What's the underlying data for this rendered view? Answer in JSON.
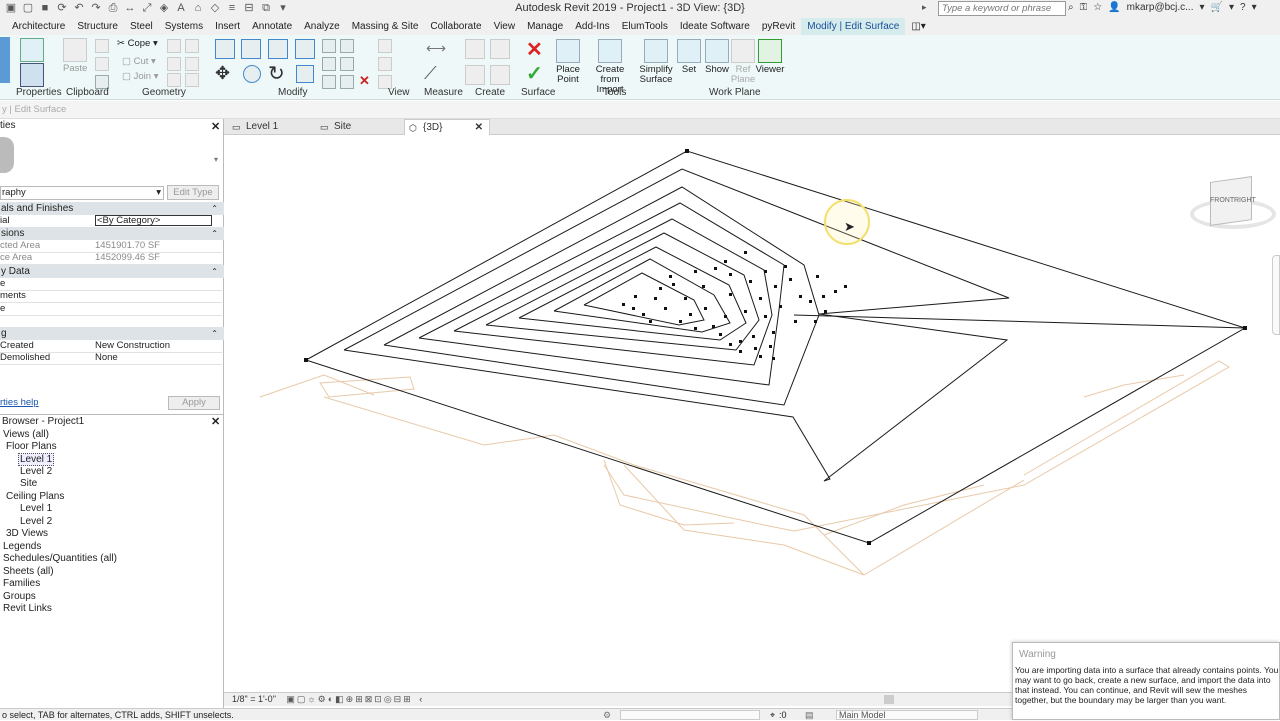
{
  "app": {
    "title": "Autodesk Revit 2019 - Project1 - 3D View: {3D}",
    "search_placeholder": "Type a keyword or phrase",
    "user": "mkarp@bcj.c..."
  },
  "menu_tabs": [
    "Architecture",
    "Structure",
    "Steel",
    "Systems",
    "Insert",
    "Annotate",
    "Analyze",
    "Massing & Site",
    "Collaborate",
    "View",
    "Manage",
    "Add-Ins",
    "ElumTools",
    "Ideate Software",
    "pyRevit",
    "Modify | Edit Surface"
  ],
  "ribbon": {
    "panels": {
      "properties": "Properties",
      "clipboard": "Clipboard",
      "geometry": "Geometry",
      "modify": "Modify",
      "view": "View",
      "measure": "Measure",
      "create": "Create",
      "surface": "Surface",
      "tools": "Tools",
      "work_plane": "Work Plane"
    },
    "buttons": {
      "paste": "Paste",
      "cope": "Cope",
      "cut": "Cut",
      "join": "Join",
      "place_point": "Place Point",
      "create_from_import": "Create from Import",
      "simplify_surface": "Simplify Surface",
      "set": "Set",
      "show": "Show",
      "ref_plane": "Ref Plane",
      "viewer": "Viewer"
    }
  },
  "options_bar": "y | Edit Surface",
  "properties": {
    "type_name": "raphy",
    "edit_type": "Edit Type",
    "sections": [
      {
        "name": "als and Finishes"
      },
      {
        "name": "sions"
      },
      {
        "name": "y Data"
      },
      {
        "name": "g"
      }
    ],
    "rows": {
      "material_key": "ial",
      "material_val": "<By Category>",
      "projected_key": "cted Area",
      "projected_val": "1451901.70 SF",
      "surface_key": "ce Area",
      "surface_val": "1452099.46 SF",
      "identity1": "e",
      "identity2": "ments",
      "identity3": "e",
      "phase_created_key": "Created",
      "phase_created_val": "New Construction",
      "phase_demolished_key": "Demolished",
      "phase_demolished_val": "None"
    },
    "help_link": "rties help",
    "apply": "Apply"
  },
  "browser": {
    "title": "Browser - Project1",
    "items": [
      "Views (all)",
      "Floor Plans",
      "Level 1",
      "Level 2",
      "Site",
      "Ceiling Plans",
      "Level 1",
      "Level 2",
      "3D Views",
      "Legends",
      "Schedules/Quantities (all)",
      "Sheets (all)",
      "Families",
      "Groups",
      "Revit Links"
    ]
  },
  "view_tabs": [
    "Level 1",
    "Site",
    "{3D}"
  ],
  "view_control": {
    "scale": "1/8\" = 1'-0\""
  },
  "viewcube": {
    "front": "FRONT",
    "right": "RIGHT"
  },
  "status": {
    "text": "o select, TAB for alternates, CTRL adds, SHIFT unselects.",
    "selection_count": ":0",
    "model": "Main Model"
  },
  "warning": {
    "title": "Warning",
    "body": "You are importing data into a surface that already contains points. You may want to go back, create a new surface, and import the data into that instead. You can continue, and Revit will sew the meshes together, but the boundary may be larger than you want."
  },
  "colors": {
    "ribbon_bg": "#eef8f8",
    "active_tab": "#d6ecec",
    "accent": "#1b4e9a",
    "ghost_lines": "#e8c9a8"
  }
}
